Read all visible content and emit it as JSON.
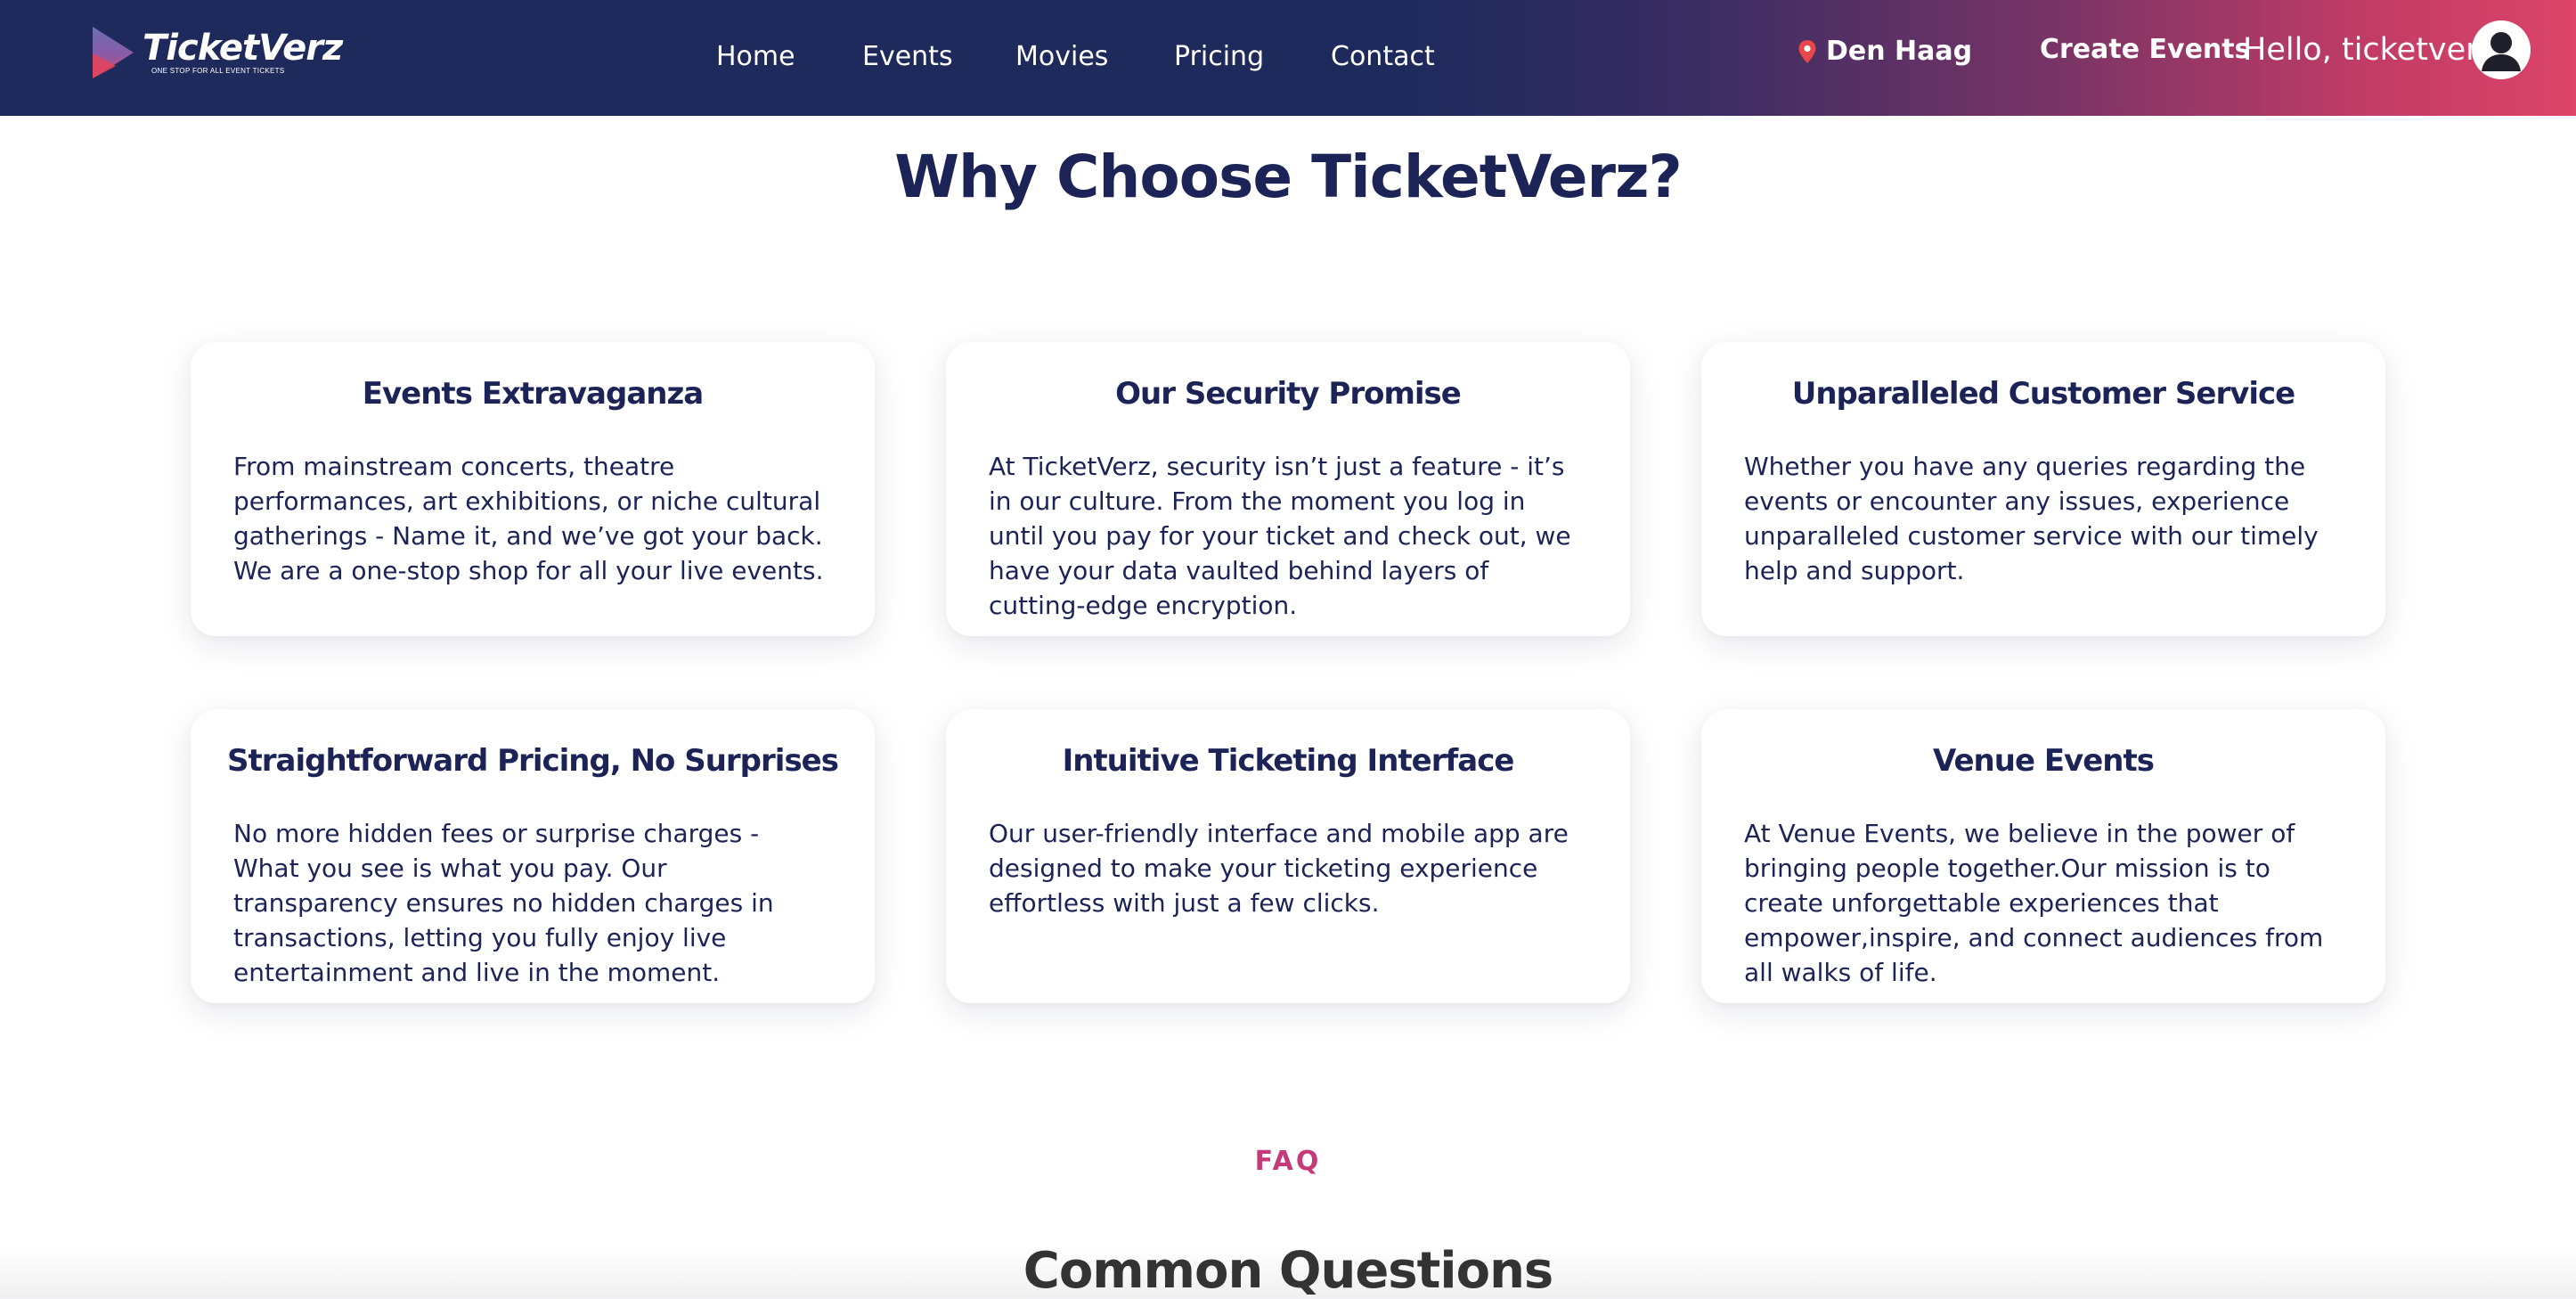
{
  "navbar": {
    "logo_text": "TicketVerz",
    "logo_tagline": "ONE STOP FOR ALL EVENT TICKETS",
    "links": [
      "Home",
      "Events",
      "Movies",
      "Pricing",
      "Contact"
    ],
    "location": "Den Haag",
    "create_events": "Create Events",
    "greeting": "Hello, ticketverz",
    "colors": {
      "gradient_start": "#1f2a5c",
      "gradient_end": "#dc4468",
      "pin": "#e8484a"
    }
  },
  "why": {
    "title": "Why Choose TicketVerz?",
    "cards": [
      {
        "title": "Events Extravaganza",
        "body": "From mainstream concerts, theatre performances, art exhibitions, or niche cultural gatherings - Name it, and we’ve got your back. We are a one-stop shop for all your live events."
      },
      {
        "title": "Our Security Promise",
        "body": "At TicketVerz, security isn’t just a feature - it’s in our culture. From the moment you log in until you pay for your ticket and check out, we have your data vaulted behind layers of cutting-edge encryption."
      },
      {
        "title": "Unparalleled Customer Service",
        "body": "Whether you have any queries regarding the events or encounter any issues, experience unparalleled customer service with our timely help and support."
      },
      {
        "title": "Straightforward Pricing, No Surprises",
        "body": "No more hidden fees or surprise charges - What you see is what you pay. Our transparency ensures no hidden charges in transactions, letting you fully enjoy live entertainment and live in the moment."
      },
      {
        "title": "Intuitive Ticketing Interface",
        "body": "Our user-friendly interface and mobile app are designed to make your ticketing experience effortless with just a few clicks."
      },
      {
        "title": "Venue Events",
        "body": "At Venue Events, we believe in the power of bringing people together.Our mission is to create unforgettable experiences that empower,inspire, and connect audiences from all walks of life."
      }
    ]
  },
  "faq": {
    "label": "FAQ",
    "title": "Common Questions"
  }
}
